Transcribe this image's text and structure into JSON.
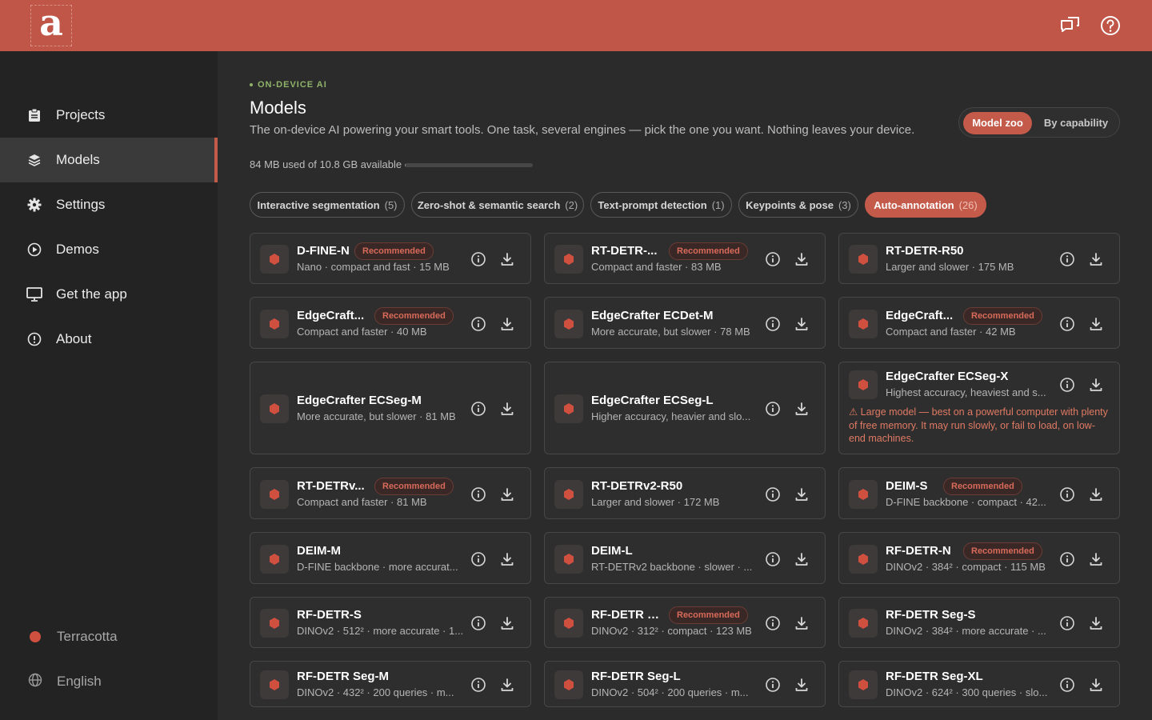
{
  "app": {
    "logo_letter": "a",
    "accent": "#c45a4a",
    "topbar_color": "#bf5647",
    "header_icons": [
      "feedback-icon",
      "help-icon"
    ]
  },
  "sidebar": {
    "items": [
      {
        "label": "Projects",
        "icon": "clipboard-icon"
      },
      {
        "label": "Models",
        "icon": "layers-icon",
        "active": true
      },
      {
        "label": "Settings",
        "icon": "gear-icon"
      },
      {
        "label": "Demos",
        "icon": "play-circle-icon"
      },
      {
        "label": "Get the app",
        "icon": "monitor-icon"
      },
      {
        "label": "About",
        "icon": "info-circle-icon"
      }
    ],
    "theme_label": "Terracotta",
    "language_label": "English"
  },
  "page": {
    "eyebrow": "ON-DEVICE AI",
    "title": "Models",
    "subtitle": "The on-device AI powering your smart tools. One task, several engines — pick the one you want. Nothing leaves your device.",
    "view_toggle": {
      "model_zoo": "Model zoo",
      "by_capability": "By capability",
      "selected": "Model zoo"
    },
    "storage": {
      "text": "84 MB used of 10.8 GB available",
      "used_fraction": 0.0076
    }
  },
  "tabs": [
    {
      "label": "Interactive segmentation",
      "count": "(5)"
    },
    {
      "label": "Zero-shot & semantic search",
      "count": "(2)"
    },
    {
      "label": "Text-prompt detection",
      "count": "(1)"
    },
    {
      "label": "Keypoints & pose",
      "count": "(3)"
    },
    {
      "label": "Auto-annotation",
      "count": "(26)",
      "active": true
    }
  ],
  "recommended_label": "Recommended",
  "models": [
    {
      "name": "D-FINE-N",
      "desc": "Nano · compact and fast · 15 MB",
      "recommended": true
    },
    {
      "name": "RT-DETR-...",
      "desc": "Compact and faster · 83 MB",
      "recommended": true
    },
    {
      "name": "RT-DETR-R50",
      "desc": "Larger and slower · 175 MB",
      "recommended": false
    },
    {
      "name": "EdgeCraft...",
      "desc": "Compact and faster · 40 MB",
      "recommended": true
    },
    {
      "name": "EdgeCrafter ECDet-M",
      "desc": "More accurate, but slower · 78 MB",
      "recommended": false
    },
    {
      "name": "EdgeCraft...",
      "desc": "Compact and faster · 42 MB",
      "recommended": true
    },
    {
      "name": "EdgeCrafter ECSeg-M",
      "desc": "More accurate, but slower · 81 MB",
      "recommended": false
    },
    {
      "name": "EdgeCrafter ECSeg-L",
      "desc": "Higher accuracy, heavier and slo...",
      "recommended": false
    },
    {
      "name": "EdgeCrafter ECSeg-X",
      "desc": "Highest accuracy, heaviest and s...",
      "recommended": false,
      "warning": "⚠ Large model — best on a powerful computer with plenty of free memory. It may run slowly, or fail to load, on low-end machines."
    },
    {
      "name": "RT-DETRv...",
      "desc": "Compact and faster · 81 MB",
      "recommended": true
    },
    {
      "name": "RT-DETRv2-R50",
      "desc": "Larger and slower · 172 MB",
      "recommended": false
    },
    {
      "name": "DEIM-S",
      "desc": "D-FINE backbone · compact · 42...",
      "recommended": true
    },
    {
      "name": "DEIM-M",
      "desc": "D-FINE backbone · more accurat...",
      "recommended": false
    },
    {
      "name": "DEIM-L",
      "desc": "RT-DETRv2 backbone · slower · ...",
      "recommended": false
    },
    {
      "name": "RF-DETR-N",
      "desc": "DINOv2 · 384² · compact · 115 MB",
      "recommended": true
    },
    {
      "name": "RF-DETR-S",
      "desc": "DINOv2 · 512² · more accurate · 1...",
      "recommended": false
    },
    {
      "name": "RF-DETR S...",
      "desc": "DINOv2 · 312² · compact · 123 MB",
      "recommended": true
    },
    {
      "name": "RF-DETR Seg-S",
      "desc": "DINOv2 · 384² · more accurate · ...",
      "recommended": false
    },
    {
      "name": "RF-DETR Seg-M",
      "desc": "DINOv2 · 432² · 200 queries · m...",
      "recommended": false
    },
    {
      "name": "RF-DETR Seg-L",
      "desc": "DINOv2 · 504² · 200 queries · m...",
      "recommended": false
    },
    {
      "name": "RF-DETR Seg-XL",
      "desc": "DINOv2 · 624² · 300 queries · slo...",
      "recommended": false
    }
  ]
}
